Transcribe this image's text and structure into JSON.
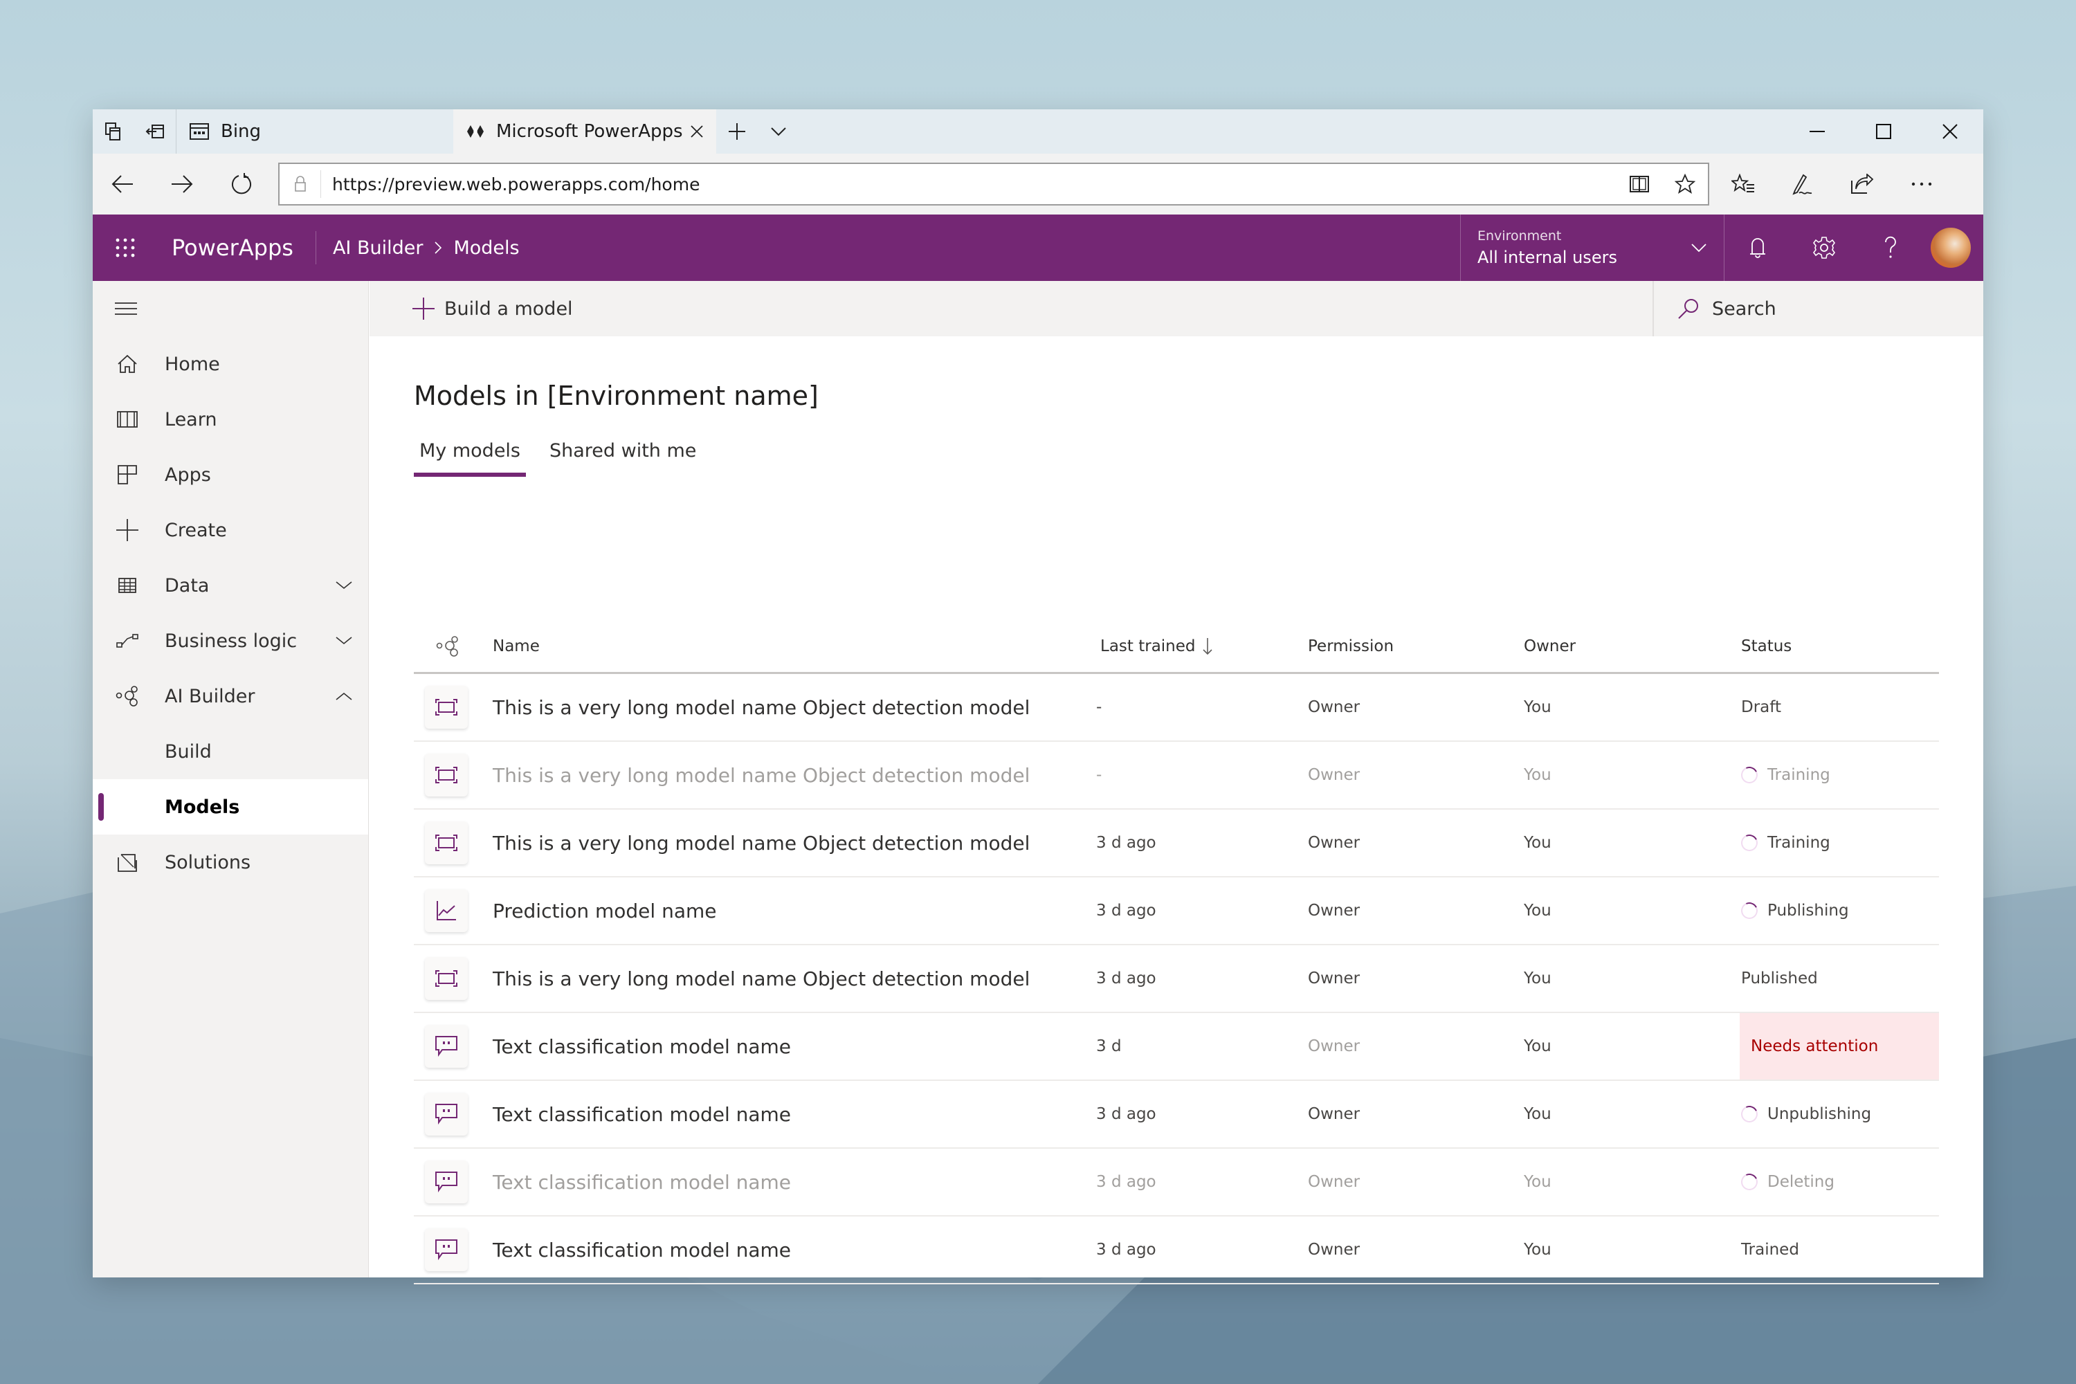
{
  "browser": {
    "tabs": [
      {
        "label": "Bing",
        "icon": "bing-page-icon",
        "active": false
      },
      {
        "label": "Microsoft PowerApps",
        "icon": "powerapps-logo-icon",
        "active": true
      }
    ],
    "url": "https://preview.web.powerapps.com/home"
  },
  "header": {
    "app_name": "PowerApps",
    "breadcrumb": [
      "AI Builder",
      "Models"
    ],
    "environment_label": "Environment",
    "environment_value": "All internal users"
  },
  "sidebar": {
    "items": [
      {
        "label": "Home",
        "icon": "home-icon"
      },
      {
        "label": "Learn",
        "icon": "book-icon"
      },
      {
        "label": "Apps",
        "icon": "apps-icon"
      },
      {
        "label": "Create",
        "icon": "plus-icon"
      },
      {
        "label": "Data",
        "icon": "table-icon",
        "chevron": "down"
      },
      {
        "label": "Business logic",
        "icon": "flow-icon",
        "chevron": "down"
      },
      {
        "label": "AI Builder",
        "icon": "ai-builder-icon",
        "chevron": "up"
      },
      {
        "label": "Build",
        "sub": true
      },
      {
        "label": "Models",
        "sub": true,
        "active": true
      },
      {
        "label": "Solutions",
        "icon": "solutions-icon"
      }
    ]
  },
  "command_bar": {
    "build_label": "Build a model",
    "search_label": "Search"
  },
  "main": {
    "title": "Models in [Environment name]",
    "tabs": [
      {
        "label": "My models",
        "selected": true
      },
      {
        "label": "Shared with me",
        "selected": false
      }
    ],
    "columns": {
      "name": "Name",
      "last_trained": "Last trained",
      "permission": "Permission",
      "owner": "Owner",
      "status": "Status"
    },
    "rows": [
      {
        "type": "object-detection",
        "name": "This is a very long model name Object detection model",
        "last_trained": "-",
        "permission": "Owner",
        "owner": "You",
        "status": "Draft",
        "busy": false,
        "dim": false
      },
      {
        "type": "object-detection",
        "name": "This is a very long model name Object detection model",
        "last_trained": "-",
        "permission": "Owner",
        "owner": "You",
        "status": "Training",
        "busy": true,
        "dim": true
      },
      {
        "type": "object-detection",
        "name": "This is a very long model name Object detection model",
        "last_trained": "3 d ago",
        "permission": "Owner",
        "owner": "You",
        "status": "Training",
        "busy": true,
        "dim": false
      },
      {
        "type": "prediction",
        "name": "Prediction model name",
        "last_trained": "3 d ago",
        "permission": "Owner",
        "owner": "You",
        "status": "Publishing",
        "busy": true,
        "dim": false
      },
      {
        "type": "object-detection",
        "name": "This is a very long model name Object detection model",
        "last_trained": "3 d ago",
        "permission": "Owner",
        "owner": "You",
        "status": "Published",
        "busy": false,
        "dim": false
      },
      {
        "type": "text-classification",
        "name": "Text classification model name",
        "last_trained": "3 d",
        "permission": "Owner",
        "owner": "You",
        "status": "Needs attention",
        "busy": false,
        "dim": false,
        "attention": true
      },
      {
        "type": "text-classification",
        "name": "Text classification model name",
        "last_trained": "3 d ago",
        "permission": "Owner",
        "owner": "You",
        "status": "Unpublishing",
        "busy": true,
        "dim": false
      },
      {
        "type": "text-classification",
        "name": "Text classification model name",
        "last_trained": "3 d ago",
        "permission": "Owner",
        "owner": "You",
        "status": "Deleting",
        "busy": true,
        "dim": true
      },
      {
        "type": "text-classification",
        "name": "Text classification model name",
        "last_trained": "3 d ago",
        "permission": "Owner",
        "owner": "You",
        "status": "Trained",
        "busy": false,
        "dim": false
      }
    ]
  },
  "colors": {
    "brand": "#742774",
    "attention_bg": "#fde7e9",
    "attention_text": "#a80000"
  }
}
